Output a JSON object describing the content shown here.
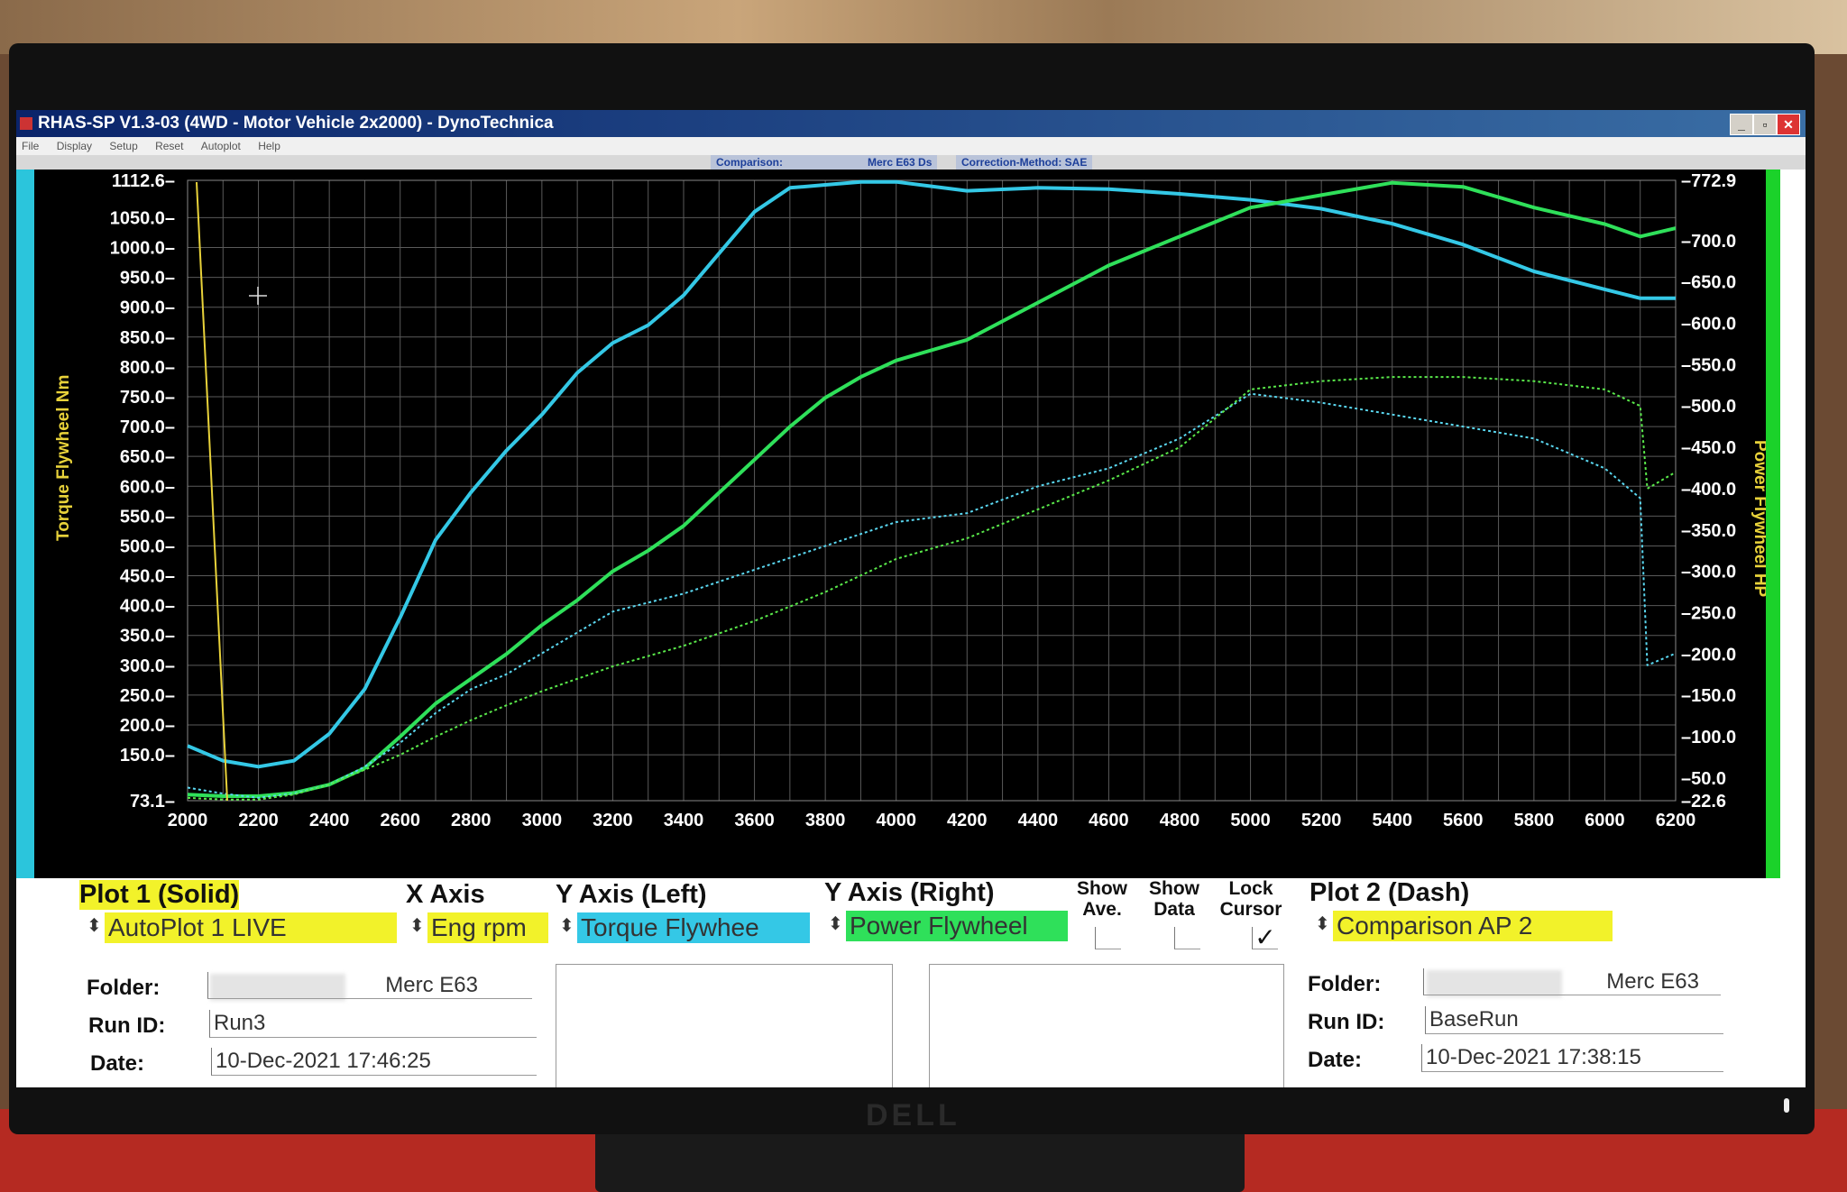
{
  "window": {
    "title": "RHAS-SP V1.3-03  (4WD - Motor Vehicle 2x2000) - DynoTechnica",
    "menu": [
      "File",
      "Display",
      "Setup",
      "Reset",
      "Autoplot",
      "Help"
    ],
    "minimize": "_",
    "restore": "▫",
    "close": "✕"
  },
  "info_bar": {
    "comparison_label": "Comparison:",
    "vehicle": "Merc E63 Ds",
    "correction": "Correction-Method: SAE"
  },
  "brand": "DELL",
  "chart_data": {
    "type": "line",
    "xlabel": "",
    "ylabel": "Torque Flywheel Nm",
    "ylabel_right": "Power Flywheel HP",
    "xlim": [
      2000,
      6200
    ],
    "ylim": [
      73.1,
      1112.6
    ],
    "ylim_right": [
      22.6,
      772.9
    ],
    "x_ticks": [
      "2000",
      "2200",
      "2400",
      "2600",
      "2800",
      "3000",
      "3200",
      "3400",
      "3600",
      "3800",
      "4000",
      "4200",
      "4400",
      "4600",
      "4800",
      "5000",
      "5200",
      "5400",
      "5600",
      "5800",
      "6000",
      "6200"
    ],
    "y_ticks_left": [
      "1112.6",
      "1050.0",
      "1000.0",
      "950.0",
      "900.0",
      "850.0",
      "800.0",
      "750.0",
      "700.0",
      "650.0",
      "600.0",
      "550.0",
      "500.0",
      "450.0",
      "400.0",
      "350.0",
      "300.0",
      "250.0",
      "200.0",
      "150.0",
      "73.1"
    ],
    "y_ticks_right": [
      "772.9",
      "700.0",
      "650.0",
      "600.0",
      "550.0",
      "500.0",
      "450.0",
      "400.0",
      "350.0",
      "300.0",
      "250.0",
      "200.0",
      "150.0",
      "100.0",
      "50.0",
      "22.6"
    ],
    "grid": true,
    "series": [
      {
        "style": "solid",
        "axis": "left",
        "color": "#34c8e6",
        "x": [
          2000,
          2100,
          2200,
          2300,
          2400,
          2500,
          2600,
          2700,
          2800,
          2900,
          3000,
          3100,
          3200,
          3300,
          3400,
          3500,
          3600,
          3700,
          3800,
          3900,
          4000,
          4200,
          4400,
          4600,
          4800,
          5000,
          5200,
          5400,
          5600,
          5800,
          6000,
          6100,
          6200
        ],
        "y": [
          165,
          140,
          130,
          140,
          185,
          260,
          380,
          510,
          590,
          660,
          720,
          790,
          840,
          870,
          920,
          990,
          1060,
          1100,
          1105,
          1110,
          1110,
          1095,
          1100,
          1098,
          1090,
          1080,
          1065,
          1040,
          1005,
          960,
          930,
          915,
          915
        ]
      },
      {
        "style": "solid",
        "axis": "right",
        "color": "#2fe05a",
        "x": [
          2000,
          2100,
          2200,
          2300,
          2400,
          2500,
          2600,
          2700,
          2800,
          2900,
          3000,
          3100,
          3200,
          3300,
          3400,
          3500,
          3600,
          3700,
          3800,
          3900,
          4000,
          4200,
          4400,
          4600,
          4800,
          5000,
          5200,
          5400,
          5600,
          5800,
          6000,
          6100,
          6200
        ],
        "y": [
          30,
          28,
          28,
          32,
          42,
          62,
          100,
          140,
          170,
          200,
          235,
          265,
          300,
          325,
          355,
          395,
          435,
          475,
          510,
          535,
          555,
          580,
          625,
          670,
          705,
          740,
          755,
          770,
          765,
          740,
          720,
          705,
          715
        ]
      },
      {
        "style": "dash",
        "axis": "left",
        "color": "#5ad7f0",
        "x": [
          2000,
          2100,
          2200,
          2300,
          2400,
          2500,
          2600,
          2700,
          2800,
          2900,
          3000,
          3200,
          3400,
          3600,
          3800,
          4000,
          4200,
          4400,
          4600,
          4800,
          5000,
          5200,
          5400,
          5600,
          5800,
          6000,
          6100,
          6120,
          6200
        ],
        "y": [
          95,
          85,
          78,
          85,
          100,
          130,
          170,
          220,
          260,
          285,
          320,
          390,
          420,
          460,
          500,
          540,
          555,
          600,
          630,
          680,
          755,
          740,
          720,
          700,
          680,
          630,
          580,
          300,
          320
        ]
      },
      {
        "style": "dash",
        "axis": "right",
        "color": "#59e84a",
        "x": [
          2000,
          2100,
          2200,
          2300,
          2400,
          2500,
          2600,
          2700,
          2800,
          2900,
          3000,
          3200,
          3400,
          3600,
          3800,
          4000,
          4200,
          4400,
          4600,
          4800,
          5000,
          5200,
          5400,
          5600,
          5800,
          6000,
          6100,
          6120,
          6200
        ],
        "y": [
          26,
          24,
          24,
          30,
          42,
          60,
          78,
          100,
          120,
          138,
          155,
          185,
          210,
          240,
          275,
          315,
          340,
          375,
          410,
          450,
          520,
          530,
          535,
          535,
          530,
          520,
          500,
          400,
          420
        ]
      }
    ]
  },
  "plot1": {
    "header": "Plot 1 (Solid)",
    "selector": "AutoPlot 1 LIVE",
    "folder_label": "Folder:",
    "folder": "Merc E63",
    "runid_label": "Run ID:",
    "runid": "Run3",
    "date_label": "Date:",
    "date": "10-Dec-2021  17:46:25"
  },
  "x_axis": {
    "header": "X Axis",
    "selector": "Eng rpm"
  },
  "y_left": {
    "header": "Y Axis (Left)",
    "selector": "Torque Flywhee"
  },
  "y_right": {
    "header": "Y Axis (Right)",
    "selector": "Power Flywheel"
  },
  "toggles": {
    "show_ave_1": "Show",
    "show_ave_2": "Ave.",
    "show_data_1": "Show",
    "show_data_2": "Data",
    "lock_cursor_1": "Lock",
    "lock_cursor_2": "Cursor",
    "lock_check": "✓"
  },
  "plot2": {
    "header": "Plot 2 (Dash)",
    "selector": "Comparison AP 2",
    "folder_label": "Folder:",
    "folder": "Merc E63",
    "runid_label": "Run ID:",
    "runid": "BaseRun",
    "date_label": "Date:",
    "date": "10-Dec-2021  17:38:15"
  },
  "spinner": "⬍"
}
